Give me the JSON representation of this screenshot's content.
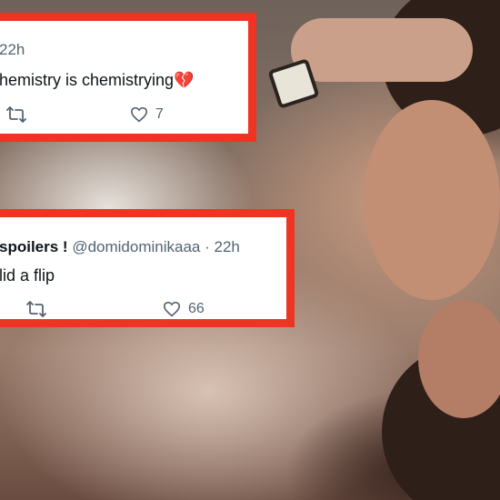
{
  "tweet1": {
    "time": "22h",
    "text": "hemistry is chemistrying",
    "emoji": "💔",
    "like_count": "7"
  },
  "tweet2": {
    "display_name": "spoilers !",
    "handle": "@domidominikaaa",
    "separator": "·",
    "time": "22h",
    "text": "lid a flip",
    "like_count": "66"
  },
  "colors": {
    "border": "#ee3423",
    "card_bg": "#ffffff",
    "text": "#0f1419",
    "muted": "#536471"
  },
  "icons": [
    "retweet-icon",
    "heart-icon",
    "broken-heart-emoji"
  ]
}
